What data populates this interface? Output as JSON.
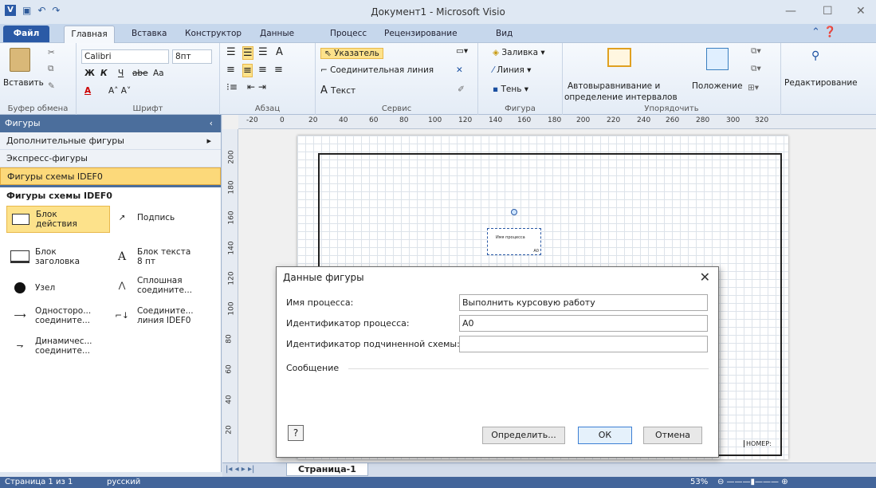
{
  "window": {
    "title": "Документ1 - Microsoft Visio",
    "minimize": "—",
    "maximize": "☐",
    "close": "✕"
  },
  "tabs": {
    "file": "Файл",
    "items": [
      "Главная",
      "Вставка",
      "Конструктор",
      "Данные",
      "Процесс",
      "Рецензирование",
      "Вид"
    ]
  },
  "ribbon": {
    "clipboard": {
      "paste": "Вставить",
      "label": "Буфер обмена"
    },
    "font": {
      "family": "Calibri",
      "size": "8пт",
      "bold": "Ж",
      "italic": "К",
      "underline": "Ч",
      "strike": "abe",
      "case": "Aa",
      "label": "Шрифт"
    },
    "paragraph": {
      "label": "Абзац"
    },
    "tools": {
      "pointer": "Указатель",
      "connector": "Соединительная линия",
      "text": "Текст",
      "label": "Сервис"
    },
    "shape": {
      "fill": "Заливка",
      "line": "Линия",
      "shadow": "Тень",
      "label": "Фигура"
    },
    "arrange": {
      "autoalign": "Автовыравнивание и",
      "autoalign2": "определение интервалов",
      "position": "Положение",
      "label": "Упорядочить"
    },
    "editing": {
      "label": "Редактирование"
    }
  },
  "sidebar": {
    "header": "Фигуры",
    "items": [
      "Дополнительные фигуры",
      "Экспресс-фигуры",
      "Фигуры схемы IDEF0"
    ],
    "section": "Фигуры схемы IDEF0",
    "shapes": [
      {
        "label": "Блок действия",
        "icon": "activity-box-icon"
      },
      {
        "label": "Подпись",
        "icon": "annotation-icon"
      },
      {
        "label": "Блок заголовка",
        "icon": "title-block-icon"
      },
      {
        "label": "Блок текста 8 пт",
        "icon": "text-block-icon"
      },
      {
        "label": "Узел",
        "icon": "node-icon"
      },
      {
        "label": "Сплошная соедините...",
        "icon": "solid-connector-icon"
      },
      {
        "label": "Односторо... соедините...",
        "icon": "one-way-connector-icon"
      },
      {
        "label": "Соедините... линия IDEF0",
        "icon": "idef0-connector-icon"
      },
      {
        "label": "Динамичес... соедините...",
        "icon": "dynamic-connector-icon"
      }
    ]
  },
  "ruler": {
    "h": [
      "-20",
      "0",
      "20",
      "40",
      "60",
      "80",
      "100",
      "120",
      "140",
      "160",
      "180",
      "200",
      "220",
      "240",
      "260",
      "280",
      "300",
      "320"
    ],
    "v": [
      "200",
      "180",
      "160",
      "140",
      "120",
      "100",
      "80",
      "60",
      "40",
      "20"
    ]
  },
  "canvas": {
    "shape_text": "Имя процесса",
    "shape_id": "A0",
    "title_block": "НОМЕР:"
  },
  "dialog": {
    "title": "Данные фигуры",
    "fields": [
      {
        "label": "Имя процесса:",
        "value": "Выполнить курсовую работу"
      },
      {
        "label": "Идентификатор процесса:",
        "value": "A0"
      },
      {
        "label": "Идентификатор подчиненной схемы:",
        "value": ""
      }
    ],
    "message": "Сообщение",
    "buttons": {
      "define": "Определить...",
      "ok": "ОК",
      "cancel": "Отмена"
    }
  },
  "sheet": {
    "tab": "Страница-1"
  },
  "status": {
    "page": "Страница 1 из 1",
    "lang": "русский",
    "zoom": "53%"
  }
}
